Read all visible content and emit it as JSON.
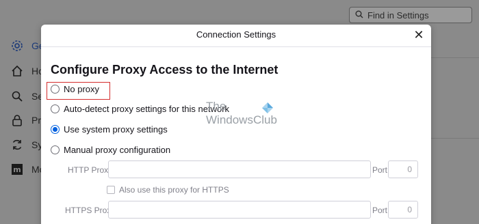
{
  "background": {
    "search_placeholder": "Find in Settings",
    "nav": [
      {
        "label": "Gen",
        "icon": "gear-icon"
      },
      {
        "label": "Hor",
        "icon": "home-icon"
      },
      {
        "label": "Sea",
        "icon": "search-icon"
      },
      {
        "label": "Priv",
        "icon": "lock-icon"
      },
      {
        "label": "Syn",
        "icon": "sync-icon"
      },
      {
        "label": "Mo",
        "icon": "mozilla-icon"
      }
    ]
  },
  "dialog": {
    "title": "Connection Settings",
    "close_icon": "close-icon",
    "heading": "Configure Proxy Access to the Internet",
    "options": [
      {
        "label": "No proxy",
        "checked": false
      },
      {
        "label": "Auto-detect proxy settings for this network",
        "checked": false
      },
      {
        "label": "Use system proxy settings",
        "checked": true
      },
      {
        "label": "Manual proxy configuration",
        "checked": false
      }
    ],
    "http_proxy_label": "HTTP Proxy",
    "http_proxy_value": "",
    "http_port_label": "Port",
    "http_port_value": "0",
    "also_https_label": "Also use this proxy for HTTPS",
    "https_proxy_label": "HTTPS Proxy",
    "https_proxy_value": "",
    "https_port_label": "Port",
    "https_port_value": "0"
  },
  "watermark": {
    "line1": "The",
    "line2": "WindowsClub"
  },
  "colors": {
    "accent": "#0060df",
    "highlight_box": "#d42b2b",
    "overlay": "#8a8a8a"
  }
}
